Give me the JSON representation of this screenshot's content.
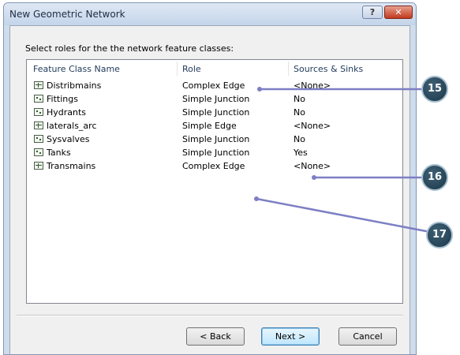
{
  "window": {
    "title": "New Geometric Network",
    "help_glyph": "?",
    "close_glyph": "✕"
  },
  "prompt": "Select roles for the the network feature classes:",
  "table": {
    "columns": [
      "Feature Class Name",
      "Role",
      "Sources & Sinks"
    ],
    "rows": [
      {
        "icon": "edge-feature-icon",
        "name": "Distribmains",
        "role": "Complex Edge",
        "sources": "<None>"
      },
      {
        "icon": "junction-feature-icon",
        "name": "Fittings",
        "role": "Simple Junction",
        "sources": "No"
      },
      {
        "icon": "junction-feature-icon",
        "name": "Hydrants",
        "role": "Simple Junction",
        "sources": "No"
      },
      {
        "icon": "edge-feature-icon",
        "name": "laterals_arc",
        "role": "Simple Edge",
        "sources": "<None>"
      },
      {
        "icon": "junction-feature-icon",
        "name": "Sysvalves",
        "role": "Simple Junction",
        "sources": "No"
      },
      {
        "icon": "junction-feature-icon",
        "name": "Tanks",
        "role": "Simple Junction",
        "sources": "Yes"
      },
      {
        "icon": "edge-feature-icon",
        "name": "Transmains",
        "role": "Complex Edge",
        "sources": "<None>"
      }
    ]
  },
  "buttons": {
    "back": "< Back",
    "next": "Next >",
    "cancel": "Cancel"
  },
  "callouts": [
    "15",
    "16",
    "17"
  ],
  "colors": {
    "callout_line": "#7d7fc4",
    "callout_badge": "#25445a"
  }
}
